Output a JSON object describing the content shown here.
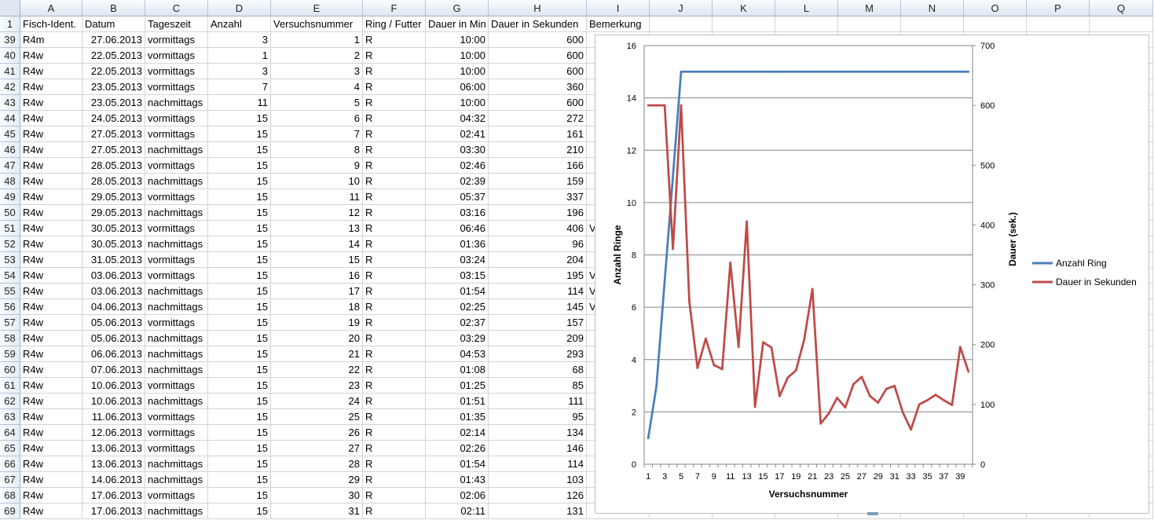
{
  "columns": [
    "A",
    "B",
    "C",
    "D",
    "E",
    "F",
    "G",
    "H",
    "I",
    "J",
    "K",
    "L",
    "M",
    "N",
    "O",
    "P",
    "Q"
  ],
  "header_row": {
    "row_number": "1",
    "cells": [
      "Fisch-Ident.",
      "Datum",
      "Tageszeit",
      "Anzahl",
      "Versuchsnummer",
      "Ring / Futter",
      "Dauer in Min",
      "Dauer in Sekunden",
      "Bemerkung"
    ]
  },
  "rows": [
    {
      "n": "39",
      "fisch": "R4m",
      "datum": "27.06.2013",
      "zeit": "vormittags",
      "anzahl": "3",
      "versuch": "1",
      "ring": "R",
      "min": "10:00",
      "sek": "600",
      "bem": ""
    },
    {
      "n": "40",
      "fisch": "R4w",
      "datum": "22.05.2013",
      "zeit": "vormittags",
      "anzahl": "1",
      "versuch": "2",
      "ring": "R",
      "min": "10:00",
      "sek": "600",
      "bem": ""
    },
    {
      "n": "41",
      "fisch": "R4w",
      "datum": "22.05.2013",
      "zeit": "vormittags",
      "anzahl": "3",
      "versuch": "3",
      "ring": "R",
      "min": "10:00",
      "sek": "600",
      "bem": ""
    },
    {
      "n": "42",
      "fisch": "R4w",
      "datum": "23.05.2013",
      "zeit": "vormittags",
      "anzahl": "7",
      "versuch": "4",
      "ring": "R",
      "min": "06:00",
      "sek": "360",
      "bem": ""
    },
    {
      "n": "43",
      "fisch": "R4w",
      "datum": "23.05.2013",
      "zeit": "nachmittags",
      "anzahl": "11",
      "versuch": "5",
      "ring": "R",
      "min": "10:00",
      "sek": "600",
      "bem": ""
    },
    {
      "n": "44",
      "fisch": "R4w",
      "datum": "24.05.2013",
      "zeit": "vormittags",
      "anzahl": "15",
      "versuch": "6",
      "ring": "R",
      "min": "04:32",
      "sek": "272",
      "bem": ""
    },
    {
      "n": "45",
      "fisch": "R4w",
      "datum": "27.05.2013",
      "zeit": "vormittags",
      "anzahl": "15",
      "versuch": "7",
      "ring": "R",
      "min": "02:41",
      "sek": "161",
      "bem": ""
    },
    {
      "n": "46",
      "fisch": "R4w",
      "datum": "27.05.2013",
      "zeit": "nachmittags",
      "anzahl": "15",
      "versuch": "8",
      "ring": "R",
      "min": "03:30",
      "sek": "210",
      "bem": ""
    },
    {
      "n": "47",
      "fisch": "R4w",
      "datum": "28.05.2013",
      "zeit": "vormittags",
      "anzahl": "15",
      "versuch": "9",
      "ring": "R",
      "min": "02:46",
      "sek": "166",
      "bem": ""
    },
    {
      "n": "48",
      "fisch": "R4w",
      "datum": "28.05.2013",
      "zeit": "nachmittags",
      "anzahl": "15",
      "versuch": "10",
      "ring": "R",
      "min": "02:39",
      "sek": "159",
      "bem": ""
    },
    {
      "n": "49",
      "fisch": "R4w",
      "datum": "29.05.2013",
      "zeit": "vormittags",
      "anzahl": "15",
      "versuch": "11",
      "ring": "R",
      "min": "05:37",
      "sek": "337",
      "bem": ""
    },
    {
      "n": "50",
      "fisch": "R4w",
      "datum": "29.05.2013",
      "zeit": "nachmittags",
      "anzahl": "15",
      "versuch": "12",
      "ring": "R",
      "min": "03:16",
      "sek": "196",
      "bem": ""
    },
    {
      "n": "51",
      "fisch": "R4w",
      "datum": "30.05.2013",
      "zeit": "vormittags",
      "anzahl": "15",
      "versuch": "13",
      "ring": "R",
      "min": "06:46",
      "sek": "406",
      "bem": "V"
    },
    {
      "n": "52",
      "fisch": "R4w",
      "datum": "30.05.2013",
      "zeit": "nachmittags",
      "anzahl": "15",
      "versuch": "14",
      "ring": "R",
      "min": "01:36",
      "sek": "96",
      "bem": ""
    },
    {
      "n": "53",
      "fisch": "R4w",
      "datum": "31.05.2013",
      "zeit": "vormittags",
      "anzahl": "15",
      "versuch": "15",
      "ring": "R",
      "min": "03:24",
      "sek": "204",
      "bem": ""
    },
    {
      "n": "54",
      "fisch": "R4w",
      "datum": "03.06.2013",
      "zeit": "vormittags",
      "anzahl": "15",
      "versuch": "16",
      "ring": "R",
      "min": "03:15",
      "sek": "195",
      "bem": "V"
    },
    {
      "n": "55",
      "fisch": "R4w",
      "datum": "03.06.2013",
      "zeit": "nachmittags",
      "anzahl": "15",
      "versuch": "17",
      "ring": "R",
      "min": "01:54",
      "sek": "114",
      "bem": "V"
    },
    {
      "n": "56",
      "fisch": "R4w",
      "datum": "04.06.2013",
      "zeit": "nachmittags",
      "anzahl": "15",
      "versuch": "18",
      "ring": "R",
      "min": "02:25",
      "sek": "145",
      "bem": "V"
    },
    {
      "n": "57",
      "fisch": "R4w",
      "datum": "05.06.2013",
      "zeit": "vormittags",
      "anzahl": "15",
      "versuch": "19",
      "ring": "R",
      "min": "02:37",
      "sek": "157",
      "bem": ""
    },
    {
      "n": "58",
      "fisch": "R4w",
      "datum": "05.06.2013",
      "zeit": "nachmittags",
      "anzahl": "15",
      "versuch": "20",
      "ring": "R",
      "min": "03:29",
      "sek": "209",
      "bem": ""
    },
    {
      "n": "59",
      "fisch": "R4w",
      "datum": "06.06.2013",
      "zeit": "nachmittags",
      "anzahl": "15",
      "versuch": "21",
      "ring": "R",
      "min": "04:53",
      "sek": "293",
      "bem": ""
    },
    {
      "n": "60",
      "fisch": "R4w",
      "datum": "07.06.2013",
      "zeit": "nachmittags",
      "anzahl": "15",
      "versuch": "22",
      "ring": "R",
      "min": "01:08",
      "sek": "68",
      "bem": ""
    },
    {
      "n": "61",
      "fisch": "R4w",
      "datum": "10.06.2013",
      "zeit": "vormittags",
      "anzahl": "15",
      "versuch": "23",
      "ring": "R",
      "min": "01:25",
      "sek": "85",
      "bem": ""
    },
    {
      "n": "62",
      "fisch": "R4w",
      "datum": "10.06.2013",
      "zeit": "nachmittags",
      "anzahl": "15",
      "versuch": "24",
      "ring": "R",
      "min": "01:51",
      "sek": "111",
      "bem": ""
    },
    {
      "n": "63",
      "fisch": "R4w",
      "datum": "11.06.2013",
      "zeit": "vormittags",
      "anzahl": "15",
      "versuch": "25",
      "ring": "R",
      "min": "01:35",
      "sek": "95",
      "bem": ""
    },
    {
      "n": "64",
      "fisch": "R4w",
      "datum": "12.06.2013",
      "zeit": "vormittags",
      "anzahl": "15",
      "versuch": "26",
      "ring": "R",
      "min": "02:14",
      "sek": "134",
      "bem": ""
    },
    {
      "n": "65",
      "fisch": "R4w",
      "datum": "13.06.2013",
      "zeit": "vormittags",
      "anzahl": "15",
      "versuch": "27",
      "ring": "R",
      "min": "02:26",
      "sek": "146",
      "bem": ""
    },
    {
      "n": "66",
      "fisch": "R4w",
      "datum": "13.06.2013",
      "zeit": "nachmittags",
      "anzahl": "15",
      "versuch": "28",
      "ring": "R",
      "min": "01:54",
      "sek": "114",
      "bem": ""
    },
    {
      "n": "67",
      "fisch": "R4w",
      "datum": "14.06.2013",
      "zeit": "nachmittags",
      "anzahl": "15",
      "versuch": "29",
      "ring": "R",
      "min": "01:43",
      "sek": "103",
      "bem": ""
    },
    {
      "n": "68",
      "fisch": "R4w",
      "datum": "17.06.2013",
      "zeit": "vormittags",
      "anzahl": "15",
      "versuch": "30",
      "ring": "R",
      "min": "02:06",
      "sek": "126",
      "bem": ""
    },
    {
      "n": "69",
      "fisch": "R4w",
      "datum": "17.06.2013",
      "zeit": "nachmittags",
      "anzahl": "15",
      "versuch": "31",
      "ring": "R",
      "min": "02:11",
      "sek": "131",
      "bem": ""
    }
  ],
  "chart_data": {
    "type": "line",
    "title": "",
    "xlabel": "Versuchsnummer",
    "ylabel": "Anzahl Ringe",
    "y2label": "Dauer (sek.)",
    "ylim": [
      0,
      16
    ],
    "y2lim": [
      0,
      700
    ],
    "yticks": [
      "0",
      "2",
      "4",
      "6",
      "8",
      "10",
      "12",
      "14",
      "16"
    ],
    "y2ticks": [
      "0",
      "100",
      "200",
      "300",
      "400",
      "500",
      "600",
      "700"
    ],
    "xtick_labels": [
      "1",
      "3",
      "5",
      "7",
      "9",
      "11",
      "13",
      "15",
      "17",
      "19",
      "21",
      "23",
      "25",
      "27",
      "29",
      "31",
      "33",
      "35",
      "37",
      "39"
    ],
    "x": [
      1,
      2,
      3,
      4,
      5,
      6,
      7,
      8,
      9,
      10,
      11,
      12,
      13,
      14,
      15,
      16,
      17,
      18,
      19,
      20,
      21,
      22,
      23,
      24,
      25,
      26,
      27,
      28,
      29,
      30,
      31,
      32,
      33,
      34,
      35,
      36,
      37,
      38,
      39,
      40
    ],
    "grid": true,
    "legend": "right",
    "series": [
      {
        "name": "Anzahl Ring",
        "axis": "left",
        "color": "#4a7ebb",
        "values": [
          1,
          3,
          7,
          11,
          15,
          15,
          15,
          15,
          15,
          15,
          15,
          15,
          15,
          15,
          15,
          15,
          15,
          15,
          15,
          15,
          15,
          15,
          15,
          15,
          15,
          15,
          15,
          15,
          15,
          15,
          15,
          15,
          15,
          15,
          15,
          15,
          15,
          15,
          15,
          15
        ]
      },
      {
        "name": "Dauer in Sekunden",
        "axis": "right",
        "color": "#be4b48",
        "values": [
          600,
          600,
          600,
          360,
          600,
          272,
          161,
          210,
          166,
          159,
          337,
          196,
          406,
          96,
          204,
          195,
          114,
          145,
          157,
          209,
          293,
          68,
          85,
          111,
          95,
          134,
          146,
          114,
          103,
          126,
          131,
          87,
          58,
          100,
          107,
          116,
          107,
          99,
          196,
          155
        ]
      }
    ]
  }
}
